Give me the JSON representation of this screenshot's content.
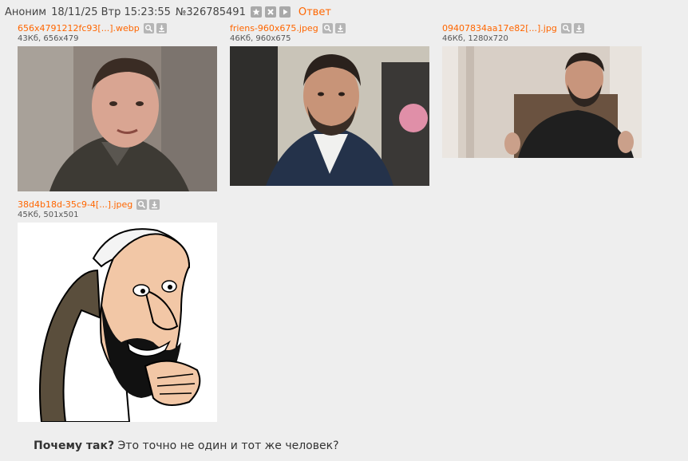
{
  "post": {
    "name": "Аноним",
    "date": "18/11/25 Втр 15:23:55",
    "number": "№326785491",
    "reply_label": "Ответ",
    "header_icons": [
      "star-icon",
      "close-icon",
      "play-icon"
    ],
    "files": [
      {
        "name": "656x4791212fc93[...].webp",
        "meta": "43Кб, 656x479"
      },
      {
        "name": "friens-960x675.jpeg",
        "meta": "46Кб, 960x675"
      },
      {
        "name": "09407834aa17e82[...].jpg",
        "meta": "46Кб, 1280x720"
      },
      {
        "name": "38d4b18d-35c9-4[...].jpeg",
        "meta": "45Кб, 501x501"
      }
    ],
    "file_icons": [
      "search-icon",
      "download-icon"
    ],
    "message_bold": "Почему так?",
    "message_rest": " Это точно не один и тот же человек?"
  },
  "colors": {
    "background": "#eeeeee",
    "link": "#ff6600",
    "text": "#333333"
  }
}
